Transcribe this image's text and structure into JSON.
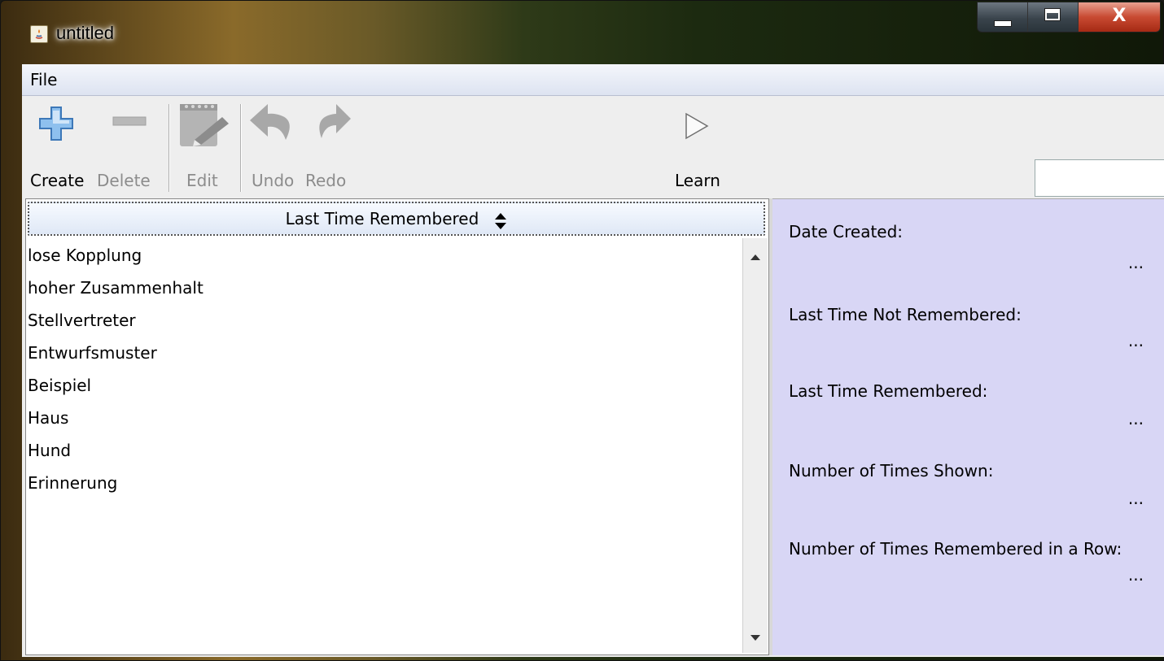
{
  "window": {
    "title": "untitled",
    "controls": {
      "minimize": "minimize",
      "maximize": "maximize",
      "close": "X"
    }
  },
  "menu": {
    "file": "File"
  },
  "toolbar": {
    "create": "Create",
    "delete": "Delete",
    "edit": "Edit",
    "undo": "Undo",
    "redo": "Redo",
    "learn": "Learn",
    "search_value": ""
  },
  "list": {
    "column_header": "Last Time Remembered",
    "items": [
      "lose Kopplung",
      "hoher Zusammenhalt",
      "Stellvertreter",
      "Entwurfsmuster",
      "Beispiel",
      "Haus",
      "Hund",
      "Erinnerung"
    ]
  },
  "details": {
    "date_created_label": "Date Created:",
    "date_created_value": "...",
    "last_not_remembered_label": "Last Time Not Remembered:",
    "last_not_remembered_value": "...",
    "last_remembered_label": "Last Time Remembered:",
    "last_remembered_value": "...",
    "times_shown_label": "Number of Times Shown:",
    "times_shown_value": "...",
    "remembered_in_row_label": "Number of Times Remembered in a Row:",
    "remembered_in_row_value": "..."
  },
  "colors": {
    "details_background": "#d8d6f5",
    "create_icon": "#4a86c8",
    "disabled_icon": "#a8a8a8"
  }
}
